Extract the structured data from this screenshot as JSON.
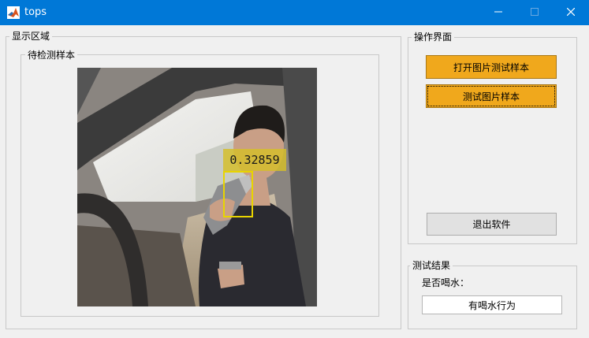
{
  "window": {
    "title": "tops",
    "icons": {
      "app": "matlab-icon",
      "minimize": "minimize-icon",
      "maximize": "maximize-icon",
      "close": "close-icon"
    }
  },
  "display_panel": {
    "title": "显示区域",
    "sample_group": {
      "title": "待检测样本"
    },
    "detection": {
      "score": "0.32859",
      "box_color": "#e8d400"
    }
  },
  "operation_panel": {
    "title": "操作界面",
    "open_button": "打开图片测试样本",
    "test_button": "测试图片样本",
    "exit_button": "退出软件"
  },
  "result_panel": {
    "title": "测试结果",
    "question_label": "是否喝水：",
    "result_value": "有喝水行为"
  },
  "colors": {
    "titlebar": "#0078d7",
    "button_accent": "#f0a81c",
    "background": "#f0f0f0"
  }
}
